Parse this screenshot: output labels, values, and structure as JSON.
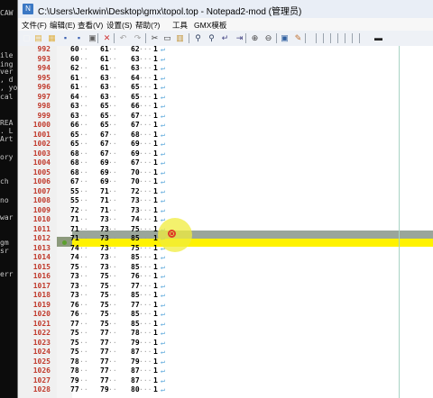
{
  "background_terminal": {
    "lines": [
      "CAW",
      "ile",
      "ing",
      "ver",
      ", d",
      ", yo",
      "cal",
      "REA",
      ". L",
      "Art",
      "ory",
      " ch",
      " no",
      "war",
      " gm",
      " sr",
      "err"
    ]
  },
  "window": {
    "title": "C:\\Users\\Jerkwin\\Desktop\\gmx\\topol.top - Notepad2-mod (管理员)",
    "menu": [
      "文件(F)",
      "编辑(E)",
      "查看(V)",
      "设置(S)",
      "帮助(?)",
      "工具",
      "GMX模板"
    ]
  },
  "toolbar": {
    "icons": [
      "new-icon",
      "open-icon",
      "browse-icon",
      "save-icon",
      "save-as-icon",
      "print-icon",
      "close-icon",
      "undo-icon",
      "redo-icon",
      "cut-icon",
      "copy-icon",
      "paste-icon",
      "find-icon",
      "replace-icon",
      "wordwrap-icon",
      "indent-icon",
      "zoom-in-icon",
      "zoom-out-icon",
      "view-icon",
      "scheme-icon",
      "run-icon"
    ]
  },
  "editor": {
    "current_line": "1011",
    "selected_line": "1012",
    "rows": [
      {
        "ln": "992",
        "a": "60",
        "b": "61",
        "c": "62",
        "d": "1"
      },
      {
        "ln": "993",
        "a": "60",
        "b": "61",
        "c": "63",
        "d": "1"
      },
      {
        "ln": "994",
        "a": "62",
        "b": "61",
        "c": "63",
        "d": "1"
      },
      {
        "ln": "995",
        "a": "61",
        "b": "63",
        "c": "64",
        "d": "1"
      },
      {
        "ln": "996",
        "a": "61",
        "b": "63",
        "c": "65",
        "d": "1"
      },
      {
        "ln": "997",
        "a": "64",
        "b": "63",
        "c": "65",
        "d": "1"
      },
      {
        "ln": "998",
        "a": "63",
        "b": "65",
        "c": "66",
        "d": "1"
      },
      {
        "ln": "999",
        "a": "63",
        "b": "65",
        "c": "67",
        "d": "1"
      },
      {
        "ln": "1000",
        "a": "66",
        "b": "65",
        "c": "67",
        "d": "1"
      },
      {
        "ln": "1001",
        "a": "65",
        "b": "67",
        "c": "68",
        "d": "1"
      },
      {
        "ln": "1002",
        "a": "65",
        "b": "67",
        "c": "69",
        "d": "1"
      },
      {
        "ln": "1003",
        "a": "68",
        "b": "67",
        "c": "69",
        "d": "1"
      },
      {
        "ln": "1004",
        "a": "68",
        "b": "69",
        "c": "67",
        "d": "1"
      },
      {
        "ln": "1005",
        "a": "68",
        "b": "69",
        "c": "70",
        "d": "1"
      },
      {
        "ln": "1006",
        "a": "67",
        "b": "69",
        "c": "70",
        "d": "1"
      },
      {
        "ln": "1007",
        "a": "55",
        "b": "71",
        "c": "72",
        "d": "1"
      },
      {
        "ln": "1008",
        "a": "55",
        "b": "71",
        "c": "73",
        "d": "1"
      },
      {
        "ln": "1009",
        "a": "72",
        "b": "71",
        "c": "73",
        "d": "1"
      },
      {
        "ln": "1010",
        "a": "71",
        "b": "73",
        "c": "74",
        "d": "1"
      },
      {
        "ln": "1011",
        "a": "71",
        "b": "73",
        "c": "75",
        "d": "1"
      },
      {
        "ln": "1012",
        "a": "71",
        "b": "73",
        "c": "85",
        "d": "1"
      },
      {
        "ln": "1013",
        "a": "74",
        "b": "73",
        "c": "75",
        "d": "1"
      },
      {
        "ln": "1014",
        "a": "74",
        "b": "73",
        "c": "85",
        "d": "1"
      },
      {
        "ln": "1015",
        "a": "75",
        "b": "73",
        "c": "85",
        "d": "1"
      },
      {
        "ln": "1016",
        "a": "73",
        "b": "75",
        "c": "76",
        "d": "1"
      },
      {
        "ln": "1017",
        "a": "73",
        "b": "75",
        "c": "77",
        "d": "1"
      },
      {
        "ln": "1018",
        "a": "73",
        "b": "75",
        "c": "85",
        "d": "1"
      },
      {
        "ln": "1019",
        "a": "76",
        "b": "75",
        "c": "77",
        "d": "1"
      },
      {
        "ln": "1020",
        "a": "76",
        "b": "75",
        "c": "85",
        "d": "1"
      },
      {
        "ln": "1021",
        "a": "77",
        "b": "75",
        "c": "85",
        "d": "1"
      },
      {
        "ln": "1022",
        "a": "75",
        "b": "77",
        "c": "78",
        "d": "1"
      },
      {
        "ln": "1023",
        "a": "75",
        "b": "77",
        "c": "79",
        "d": "1"
      },
      {
        "ln": "1024",
        "a": "75",
        "b": "77",
        "c": "87",
        "d": "1"
      },
      {
        "ln": "1025",
        "a": "78",
        "b": "77",
        "c": "79",
        "d": "1"
      },
      {
        "ln": "1026",
        "a": "78",
        "b": "77",
        "c": "87",
        "d": "1"
      },
      {
        "ln": "1027",
        "a": "79",
        "b": "77",
        "c": "87",
        "d": "1"
      },
      {
        "ln": "1028",
        "a": "77",
        "b": "79",
        "c": "80",
        "d": "1"
      }
    ]
  },
  "colors": {
    "line_number": "#c0392b",
    "current_line_bg": "#9aa69a",
    "selection_bg": "#fff200",
    "long_line_edge": "#a8d3c4"
  }
}
